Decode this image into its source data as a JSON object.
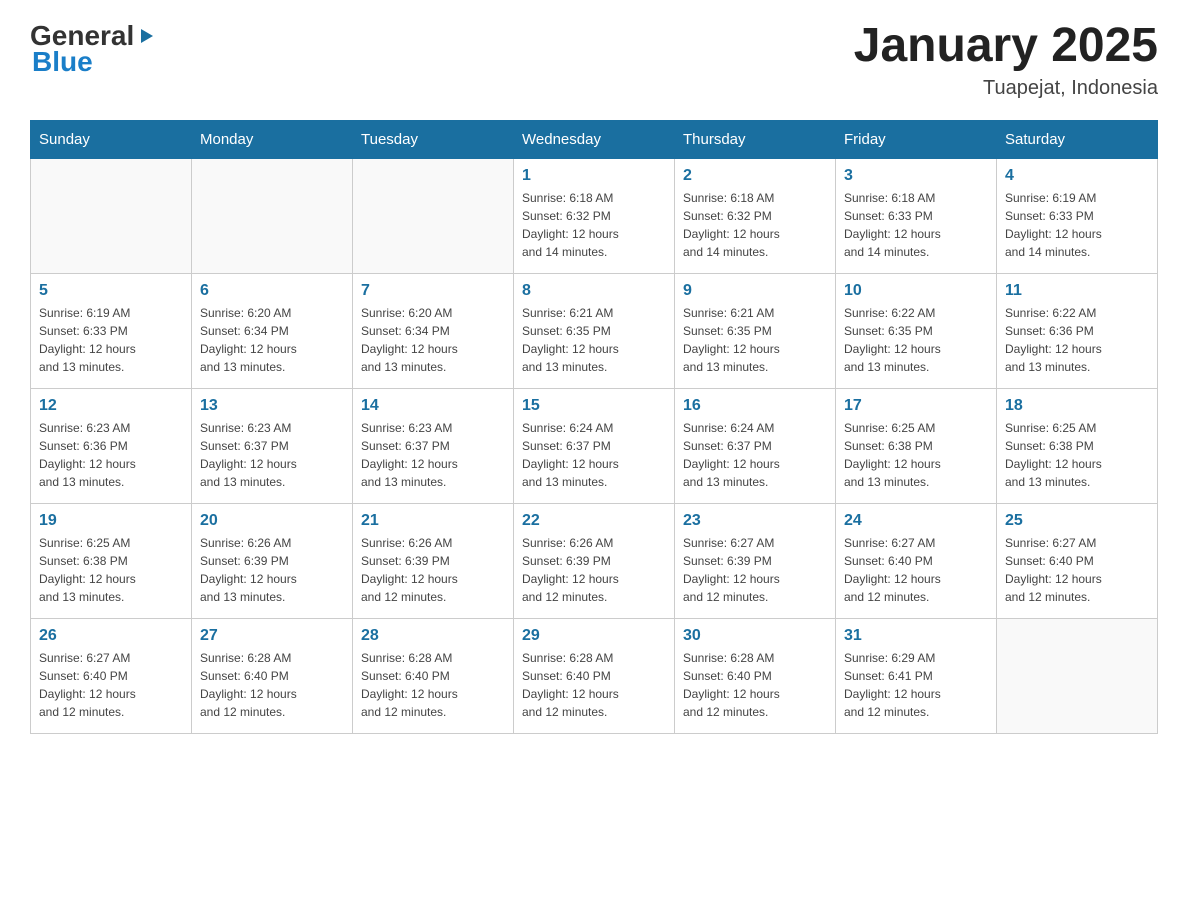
{
  "header": {
    "logo_general": "General",
    "logo_blue": "Blue",
    "month_title": "January 2025",
    "location": "Tuapejat, Indonesia"
  },
  "days_of_week": [
    "Sunday",
    "Monday",
    "Tuesday",
    "Wednesday",
    "Thursday",
    "Friday",
    "Saturday"
  ],
  "weeks": [
    [
      {
        "day": "",
        "info": ""
      },
      {
        "day": "",
        "info": ""
      },
      {
        "day": "",
        "info": ""
      },
      {
        "day": "1",
        "info": "Sunrise: 6:18 AM\nSunset: 6:32 PM\nDaylight: 12 hours\nand 14 minutes."
      },
      {
        "day": "2",
        "info": "Sunrise: 6:18 AM\nSunset: 6:32 PM\nDaylight: 12 hours\nand 14 minutes."
      },
      {
        "day": "3",
        "info": "Sunrise: 6:18 AM\nSunset: 6:33 PM\nDaylight: 12 hours\nand 14 minutes."
      },
      {
        "day": "4",
        "info": "Sunrise: 6:19 AM\nSunset: 6:33 PM\nDaylight: 12 hours\nand 14 minutes."
      }
    ],
    [
      {
        "day": "5",
        "info": "Sunrise: 6:19 AM\nSunset: 6:33 PM\nDaylight: 12 hours\nand 13 minutes."
      },
      {
        "day": "6",
        "info": "Sunrise: 6:20 AM\nSunset: 6:34 PM\nDaylight: 12 hours\nand 13 minutes."
      },
      {
        "day": "7",
        "info": "Sunrise: 6:20 AM\nSunset: 6:34 PM\nDaylight: 12 hours\nand 13 minutes."
      },
      {
        "day": "8",
        "info": "Sunrise: 6:21 AM\nSunset: 6:35 PM\nDaylight: 12 hours\nand 13 minutes."
      },
      {
        "day": "9",
        "info": "Sunrise: 6:21 AM\nSunset: 6:35 PM\nDaylight: 12 hours\nand 13 minutes."
      },
      {
        "day": "10",
        "info": "Sunrise: 6:22 AM\nSunset: 6:35 PM\nDaylight: 12 hours\nand 13 minutes."
      },
      {
        "day": "11",
        "info": "Sunrise: 6:22 AM\nSunset: 6:36 PM\nDaylight: 12 hours\nand 13 minutes."
      }
    ],
    [
      {
        "day": "12",
        "info": "Sunrise: 6:23 AM\nSunset: 6:36 PM\nDaylight: 12 hours\nand 13 minutes."
      },
      {
        "day": "13",
        "info": "Sunrise: 6:23 AM\nSunset: 6:37 PM\nDaylight: 12 hours\nand 13 minutes."
      },
      {
        "day": "14",
        "info": "Sunrise: 6:23 AM\nSunset: 6:37 PM\nDaylight: 12 hours\nand 13 minutes."
      },
      {
        "day": "15",
        "info": "Sunrise: 6:24 AM\nSunset: 6:37 PM\nDaylight: 12 hours\nand 13 minutes."
      },
      {
        "day": "16",
        "info": "Sunrise: 6:24 AM\nSunset: 6:37 PM\nDaylight: 12 hours\nand 13 minutes."
      },
      {
        "day": "17",
        "info": "Sunrise: 6:25 AM\nSunset: 6:38 PM\nDaylight: 12 hours\nand 13 minutes."
      },
      {
        "day": "18",
        "info": "Sunrise: 6:25 AM\nSunset: 6:38 PM\nDaylight: 12 hours\nand 13 minutes."
      }
    ],
    [
      {
        "day": "19",
        "info": "Sunrise: 6:25 AM\nSunset: 6:38 PM\nDaylight: 12 hours\nand 13 minutes."
      },
      {
        "day": "20",
        "info": "Sunrise: 6:26 AM\nSunset: 6:39 PM\nDaylight: 12 hours\nand 13 minutes."
      },
      {
        "day": "21",
        "info": "Sunrise: 6:26 AM\nSunset: 6:39 PM\nDaylight: 12 hours\nand 12 minutes."
      },
      {
        "day": "22",
        "info": "Sunrise: 6:26 AM\nSunset: 6:39 PM\nDaylight: 12 hours\nand 12 minutes."
      },
      {
        "day": "23",
        "info": "Sunrise: 6:27 AM\nSunset: 6:39 PM\nDaylight: 12 hours\nand 12 minutes."
      },
      {
        "day": "24",
        "info": "Sunrise: 6:27 AM\nSunset: 6:40 PM\nDaylight: 12 hours\nand 12 minutes."
      },
      {
        "day": "25",
        "info": "Sunrise: 6:27 AM\nSunset: 6:40 PM\nDaylight: 12 hours\nand 12 minutes."
      }
    ],
    [
      {
        "day": "26",
        "info": "Sunrise: 6:27 AM\nSunset: 6:40 PM\nDaylight: 12 hours\nand 12 minutes."
      },
      {
        "day": "27",
        "info": "Sunrise: 6:28 AM\nSunset: 6:40 PM\nDaylight: 12 hours\nand 12 minutes."
      },
      {
        "day": "28",
        "info": "Sunrise: 6:28 AM\nSunset: 6:40 PM\nDaylight: 12 hours\nand 12 minutes."
      },
      {
        "day": "29",
        "info": "Sunrise: 6:28 AM\nSunset: 6:40 PM\nDaylight: 12 hours\nand 12 minutes."
      },
      {
        "day": "30",
        "info": "Sunrise: 6:28 AM\nSunset: 6:40 PM\nDaylight: 12 hours\nand 12 minutes."
      },
      {
        "day": "31",
        "info": "Sunrise: 6:29 AM\nSunset: 6:41 PM\nDaylight: 12 hours\nand 12 minutes."
      },
      {
        "day": "",
        "info": ""
      }
    ]
  ]
}
